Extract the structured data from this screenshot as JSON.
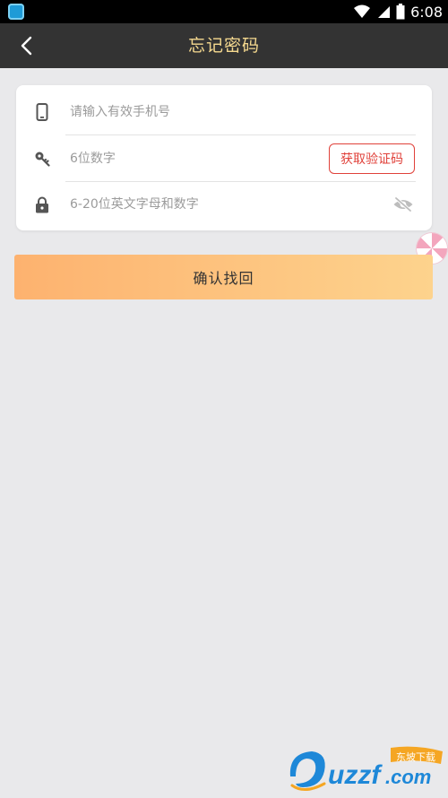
{
  "status_bar": {
    "time": "6:08"
  },
  "header": {
    "title": "忘记密码"
  },
  "form": {
    "phone_placeholder": "请输入有效手机号",
    "phone_value": "",
    "code_placeholder": "6位数字",
    "code_value": "",
    "get_code_label": "获取验证码",
    "password_placeholder": "6-20位英文字母和数字",
    "password_value": ""
  },
  "submit_label": "确认找回",
  "watermark": {
    "brand_text": "uzzf.com",
    "tag_text": "东坡下载"
  },
  "colors": {
    "appbar": "#333333",
    "title": "#f5d98f",
    "accent_red": "#e0413a",
    "button_start": "#fdb26f",
    "button_end": "#fdd38d"
  },
  "icons": [
    "back-chevron-icon",
    "phone-icon",
    "key-icon",
    "lock-icon",
    "eye-off-icon",
    "wifi-icon",
    "signal-icon",
    "battery-icon"
  ]
}
